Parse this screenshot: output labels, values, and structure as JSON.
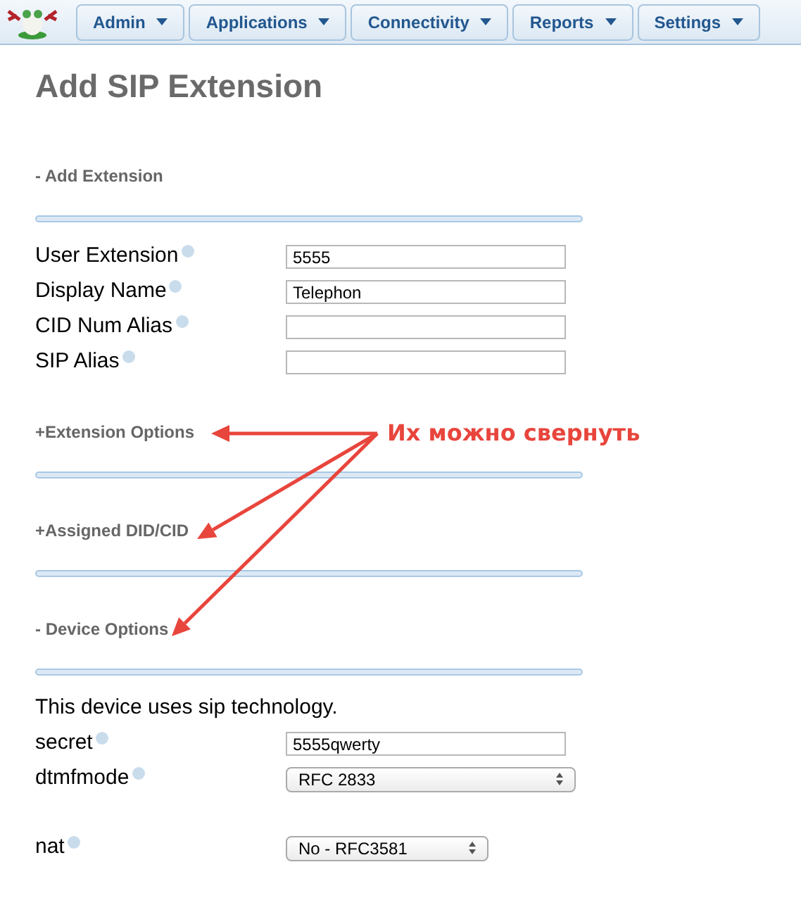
{
  "nav": [
    {
      "label": "Admin"
    },
    {
      "label": "Applications"
    },
    {
      "label": "Connectivity"
    },
    {
      "label": "Reports"
    },
    {
      "label": "Settings"
    }
  ],
  "title": "Add SIP Extension",
  "sections": [
    {
      "label": "- Add Extension",
      "fields": [
        {
          "kind": "text",
          "label": "User Extension",
          "value": "5555"
        },
        {
          "kind": "text",
          "label": "Display Name",
          "value": "Telephon"
        },
        {
          "kind": "text",
          "label": "CID Num Alias"
        },
        {
          "kind": "text",
          "label": "SIP Alias"
        }
      ]
    },
    {
      "label": "+Extension Options"
    },
    {
      "label": "+Assigned DID/CID"
    },
    {
      "label": "- Device Options",
      "note": "This device uses sip technology.",
      "fields": [
        {
          "kind": "text",
          "label": "secret",
          "value": "5555qwerty"
        },
        {
          "kind": "select",
          "label": "dtmfmode",
          "value": "RFC 2833"
        },
        {
          "kind": "select",
          "label": "nat",
          "value": "No - RFC3581"
        }
      ]
    }
  ],
  "annotation": "Их можно свернуть"
}
